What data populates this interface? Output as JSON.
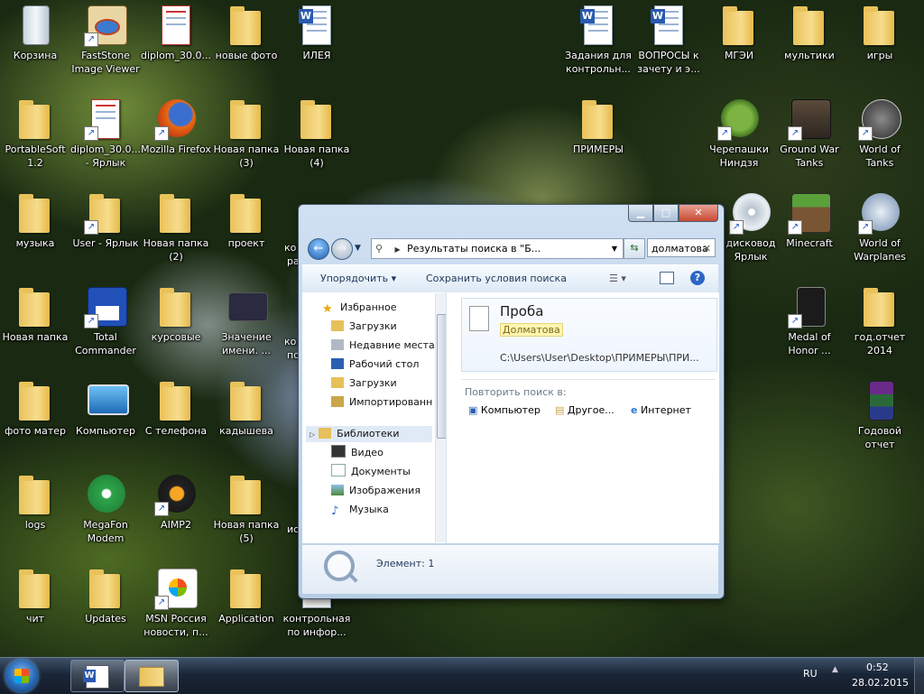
{
  "desktop": {
    "icons": [
      {
        "label": "Корзина"
      },
      {
        "label": "FastStone Image Viewer"
      },
      {
        "label": "diplom_30.0..."
      },
      {
        "label": "новые фото"
      },
      {
        "label": "ИЛЕЯ"
      },
      {
        "label": "Задания для контрольн..."
      },
      {
        "label": "ВОПРОСЫ к зачету и э..."
      },
      {
        "label": "МГЭИ"
      },
      {
        "label": "мультики"
      },
      {
        "label": "игры"
      },
      {
        "label": "PortableSoft 1.2"
      },
      {
        "label": "diplom_30.0... - Ярлык"
      },
      {
        "label": "Mozilla Firefox"
      },
      {
        "label": "Новая папка (3)"
      },
      {
        "label": "Новая папка (4)"
      },
      {
        "label": "ПРИМЕРЫ"
      },
      {
        "label": "Черепашки Ниндзя"
      },
      {
        "label": "Ground War Tanks"
      },
      {
        "label": "World of Tanks"
      },
      {
        "label": "музыка"
      },
      {
        "label": "User - Ярлык"
      },
      {
        "label": "Новая папка (2)"
      },
      {
        "label": "проект"
      },
      {
        "label": "дисковод Ярлык"
      },
      {
        "label": "Minecraft"
      },
      {
        "label": "World of Warplanes"
      },
      {
        "label": "Новая папка"
      },
      {
        "label": "Total Commander"
      },
      {
        "label": "курсовые"
      },
      {
        "label": "Значение имени. ..."
      },
      {
        "label": "Medal of Honor ..."
      },
      {
        "label": "год.отчет 2014"
      },
      {
        "label": "фото матер"
      },
      {
        "label": "Компьютер"
      },
      {
        "label": "С телефона"
      },
      {
        "label": "кадышева"
      },
      {
        "label": "Годовой отчет"
      },
      {
        "label": "logs"
      },
      {
        "label": "MegaFon Modem"
      },
      {
        "label": "AIMP2"
      },
      {
        "label": "Новая папка (5)"
      },
      {
        "label": "чит"
      },
      {
        "label": "Updates"
      },
      {
        "label": "MSN Россия новости, п..."
      },
      {
        "label": "Application"
      },
      {
        "label": "контрольная по инфор..."
      }
    ],
    "partial_labels": [
      "ко",
      "ра",
      "ко",
      "по",
      "ис"
    ]
  },
  "explorer": {
    "address": "Результаты поиска в \"Б...",
    "search_value": "долматова",
    "toolbar": {
      "organize": "Упорядочить",
      "save_search": "Сохранить условия поиска"
    },
    "nav": {
      "favorites": "Избранное",
      "items": [
        "Загрузки",
        "Недавние места",
        "Рабочий стол",
        "Загрузки",
        "Импортированн"
      ],
      "libraries": "Библиотеки",
      "lib_items": [
        "Видео",
        "Документы",
        "Изображения",
        "Музыка"
      ]
    },
    "result": {
      "name": "Проба",
      "highlight": "Долматова",
      "path": "C:\\Users\\User\\Desktop\\ПРИМЕРЫ\\ПРИ..."
    },
    "repeat": {
      "label": "Повторить поиск в:",
      "options": [
        "Компьютер",
        "Другое...",
        "Интернет"
      ]
    },
    "status": "Элемент: 1"
  },
  "taskbar": {
    "lang": "RU",
    "time": "0:52",
    "date": "28.02.2015"
  }
}
